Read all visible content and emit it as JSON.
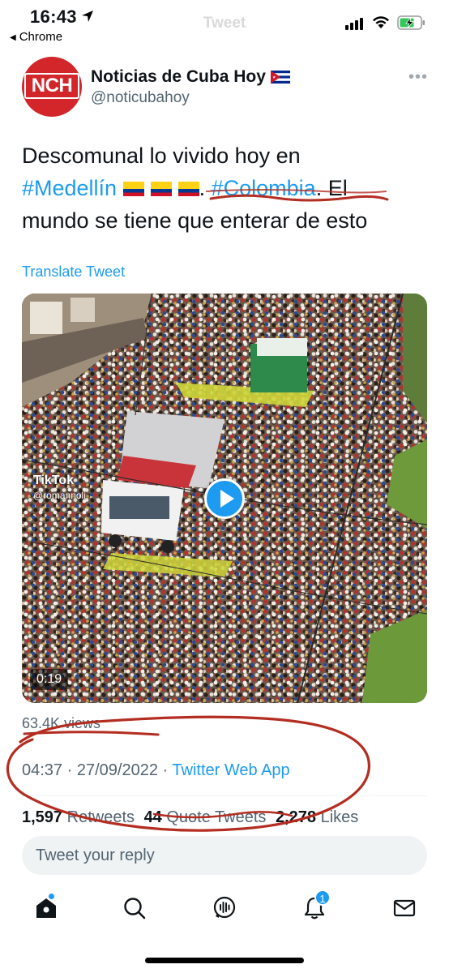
{
  "status_bar": {
    "time": "16:43",
    "back_app": "Chrome",
    "ghost_title": "Tweet"
  },
  "tweet": {
    "author_name": "Noticias de Cuba Hoy",
    "author_handle": "@noticubahoy",
    "avatar_text": "NCH",
    "text_line1": "Descomunal lo vivido hoy en",
    "hashtag1": "#Medellín",
    "hashtag2": "#Colombia",
    "text_period": ".",
    "text_after": "El",
    "text_line3": "mundo se tiene que enterar de esto",
    "translate_label": "Translate Tweet"
  },
  "video": {
    "duration": "0:19",
    "watermark": "TikTok",
    "watermark_user": "@romannoli"
  },
  "meta": {
    "views": "63.4K views",
    "time": "04:37",
    "separator": "·",
    "date": "27/09/2022",
    "source": "Twitter Web App"
  },
  "stats": {
    "retweets_count": "1,597",
    "retweets_label": "Retweets",
    "quotes_count": "44",
    "quotes_label": "Quote Tweets",
    "likes_count": "2,278",
    "likes_label": "Likes"
  },
  "reply": {
    "placeholder": "Tweet your reply"
  },
  "tab_bar": {
    "notifications_badge": "1"
  },
  "colors": {
    "accent": "#1d9bf0",
    "annotation": "#c0392b",
    "avatar": "#d3262a"
  }
}
